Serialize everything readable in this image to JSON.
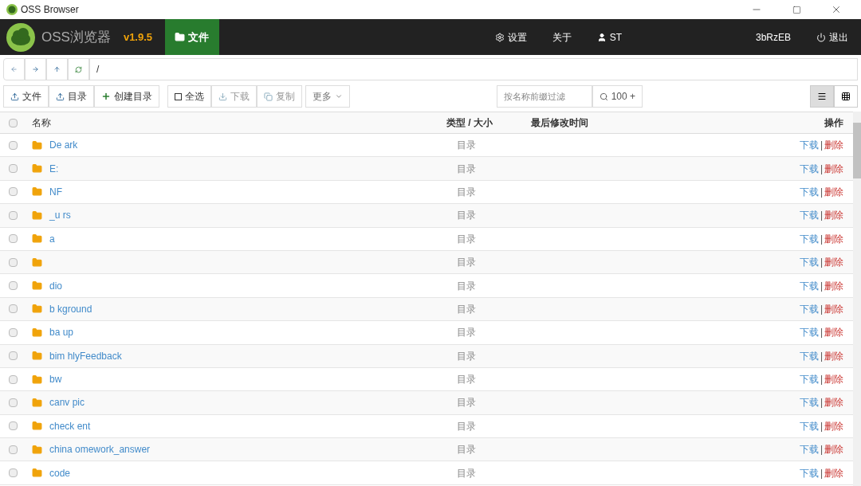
{
  "window": {
    "title": "OSS Browser"
  },
  "header": {
    "app_name": "OSS浏览器",
    "version": "v1.9.5",
    "tabs": [
      {
        "label": "文件",
        "selected": true
      }
    ],
    "menu": [
      "设置",
      "关于"
    ],
    "user_prefix": "ST",
    "user_suffix": "3bRzEB",
    "logout": "退出"
  },
  "path": "/",
  "toolbar": {
    "upload_file": "文件",
    "upload_dir": "目录",
    "create_dir": "创建目录",
    "select_all": "全选",
    "download": "下载",
    "copy": "复制",
    "more": "更多",
    "filter_placeholder": "按名称前缀过滤",
    "search": "100 +",
    "views": [
      {
        "kind": "list",
        "selected": true
      },
      {
        "kind": "grid",
        "selected": false
      }
    ]
  },
  "table": {
    "all_checked": false,
    "columns": [
      "名称",
      "类型 / 大小",
      "最后修改时间",
      "操作"
    ],
    "rows": [
      {
        "name": "De ark",
        "type": "目录",
        "checked": false,
        "download": "下载",
        "separator": "|",
        "delete": "删除"
      },
      {
        "name": "E:",
        "type": "目录",
        "checked": false,
        "download": "下载",
        "separator": "|",
        "delete": "删除"
      },
      {
        "name": "NF",
        "type": "目录",
        "checked": false,
        "download": "下载",
        "separator": "|",
        "delete": "删除"
      },
      {
        "name": "_u rs",
        "type": "目录",
        "checked": false,
        "download": "下载",
        "separator": "|",
        "delete": "删除"
      },
      {
        "name": "a",
        "type": "目录",
        "checked": false,
        "download": "下载",
        "separator": "|",
        "delete": "删除"
      },
      {
        "type": "目录",
        "checked": false,
        "download": "下载",
        "separator": "|",
        "delete": "删除"
      },
      {
        "name": "dio",
        "type": "目录",
        "checked": false,
        "download": "下载",
        "separator": "|",
        "delete": "删除"
      },
      {
        "name": "b kground",
        "type": "目录",
        "checked": false,
        "download": "下载",
        "separator": "|",
        "delete": "删除"
      },
      {
        "name": "ba up",
        "type": "目录",
        "checked": false,
        "download": "下载",
        "separator": "|",
        "delete": "删除"
      },
      {
        "name": "bim hlyFeedback",
        "type": "目录",
        "checked": false,
        "download": "下载",
        "separator": "|",
        "delete": "删除"
      },
      {
        "name": "bw",
        "type": "目录",
        "checked": false,
        "download": "下载",
        "separator": "|",
        "delete": "删除"
      },
      {
        "name": "canv pic",
        "type": "目录",
        "checked": false,
        "download": "下载",
        "separator": "|",
        "delete": "删除"
      },
      {
        "name": "check ent",
        "type": "目录",
        "checked": false,
        "download": "下载",
        "separator": "|",
        "delete": "删除"
      },
      {
        "name": "china omework_answer",
        "type": "目录",
        "checked": false,
        "download": "下载",
        "separator": "|",
        "delete": "删除"
      },
      {
        "name": "code",
        "type": "目录",
        "checked": false,
        "download": "下载",
        "separator": "|",
        "delete": "删除"
      }
    ]
  }
}
